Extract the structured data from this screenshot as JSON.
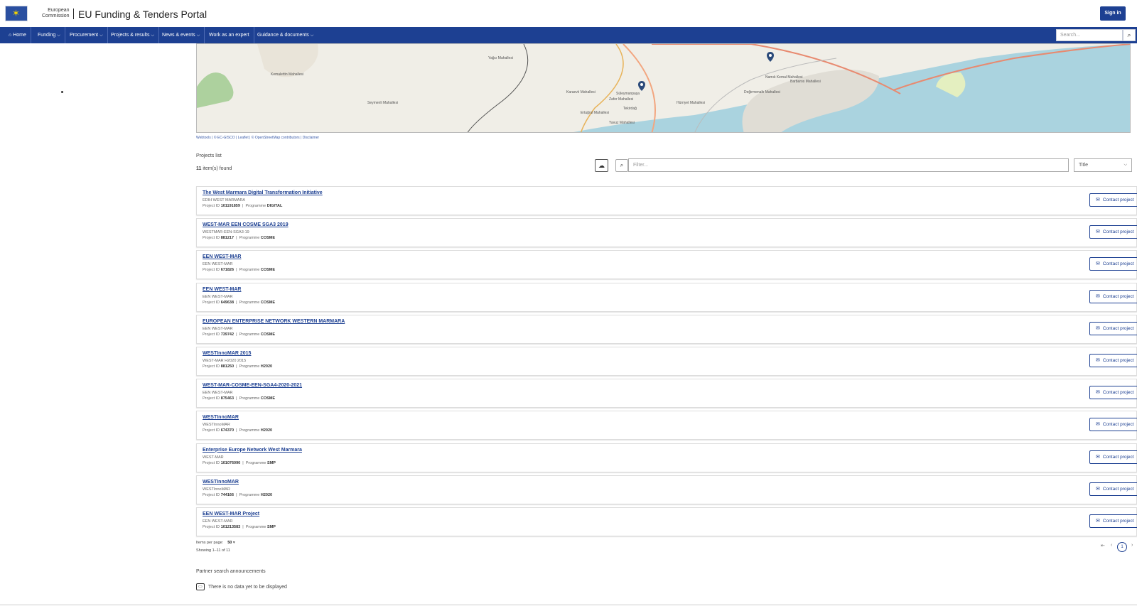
{
  "header": {
    "org_line1": "European",
    "org_line2": "Commission",
    "title": "EU Funding & Tenders Portal",
    "signin": "Sign in"
  },
  "nav": {
    "items": [
      {
        "label": "Home",
        "icon": "home-icon"
      },
      {
        "label": "Funding",
        "dropdown": true
      },
      {
        "label": "Procurement",
        "dropdown": true
      },
      {
        "label": "Projects & results",
        "dropdown": true
      },
      {
        "label": "News & events",
        "dropdown": true
      },
      {
        "label": "Work as an expert",
        "dropdown": false
      },
      {
        "label": "Guidance & documents",
        "dropdown": true
      }
    ],
    "search_placeholder": "Search..."
  },
  "map": {
    "labels": [
      "Yağcı Mahallesi",
      "Kemalettin Mahallesi",
      "Seymenli Mahallesi",
      "Karaevlı Mahallesi",
      "Süleymanpaşa",
      "Zafer Mahallesi",
      "Tekirdağ",
      "Ertuğrul Mahallesi",
      "Yavuz Mahallesi",
      "Hürriyet Mahallesi",
      "Değirmenaltı Mahallesi",
      "Namık Kemal Mahallesi",
      "Barbaros Mahallesi"
    ],
    "attribution": "Webtools | © EC-GISCO | Leaflet | © OpenStreetMap contributors | Disclaimer"
  },
  "projects": {
    "heading": "Projects list",
    "count_number": "11",
    "count_text": "item(s) found",
    "filter_placeholder": "Filter...",
    "sort_value": "Title",
    "contact_label": "Contact project",
    "id_label": "Project ID",
    "programme_label": "Programme",
    "items": [
      {
        "title": "The West Marmara Digital Transformation Initiative",
        "acronym": "EDIH WEST MARMARA",
        "id": "101191859",
        "programme": "DIGITAL"
      },
      {
        "title": "WEST-MAR EEN COSME SGA3 2019",
        "acronym": "WESTMAR-EEN-SGA3-19",
        "id": "881217",
        "programme": "COSME"
      },
      {
        "title": "EEN WEST-MAR",
        "acronym": "EEN WEST-MAR",
        "id": "671826",
        "programme": "COSME"
      },
      {
        "title": "EEN WEST-MAR",
        "acronym": "EEN WEST-MAR",
        "id": "649638",
        "programme": "COSME"
      },
      {
        "title": "EUROPEAN ENTERPRISE NETWORK WESTERN MARMARA",
        "acronym": "EEN WEST-MAR",
        "id": "739742",
        "programme": "COSME"
      },
      {
        "title": "WESTInnoMAR 2015",
        "acronym": "WEST-MAR H2020 2015",
        "id": "881250",
        "programme": "H2020"
      },
      {
        "title": "WEST-MAR-COSME-EEN-SGA4-2020-2021",
        "acronym": "EEN WEST-MAR",
        "id": "875463",
        "programme": "COSME"
      },
      {
        "title": "WESTInnoMAR",
        "acronym": "WESTInnoMAR",
        "id": "674370",
        "programme": "H2020"
      },
      {
        "title": "Enterprise Europe Network West Marmara",
        "acronym": "WEST-MAR",
        "id": "101076090",
        "programme": "SMP"
      },
      {
        "title": "WESTInnoMAR",
        "acronym": "WESTInnoMAR",
        "id": "744166",
        "programme": "H2020"
      },
      {
        "title": "EEN WEST-MAR Project",
        "acronym": "EEN WEST-MAR",
        "id": "101213583",
        "programme": "SMP"
      }
    ]
  },
  "pagination": {
    "items_per_page_label": "Items per page:",
    "items_per_page_value": "50",
    "showing": "Showing 1–11 of 11",
    "current_page": "1"
  },
  "partner": {
    "heading": "Partner search announcements",
    "empty": "There is no data yet to be displayed"
  },
  "colors": {
    "brand": "#1d4092",
    "map_sea": "#aad3df",
    "map_land": "#f0eee7"
  }
}
